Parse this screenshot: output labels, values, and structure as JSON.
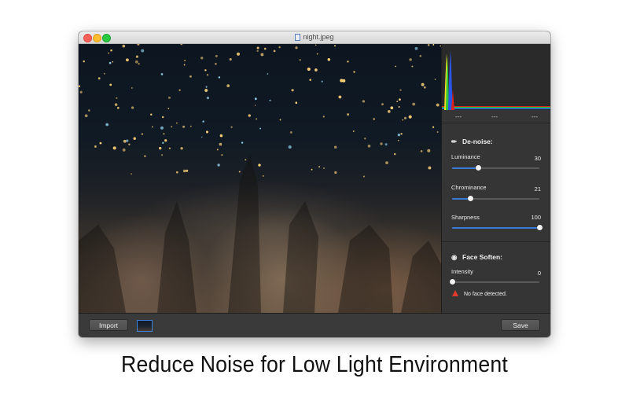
{
  "window": {
    "title": "night.jpeg",
    "title_icon": "document-icon"
  },
  "photo": {
    "description_icon": "photo-preview"
  },
  "histogram": {
    "readouts": [
      "---",
      "---",
      "---"
    ],
    "colors": {
      "red": "#e0201a",
      "green": "#2ec43c",
      "blue": "#2a55e6",
      "yellow": "#f0e020"
    }
  },
  "denoise": {
    "title": "De-noise:",
    "icon": "brush-icon",
    "sliders": [
      {
        "label": "Luminance",
        "value": "30",
        "fraction": 0.3
      },
      {
        "label": "Chrominance",
        "value": "21",
        "fraction": 0.21
      },
      {
        "label": "Sharpness",
        "value": "100",
        "fraction": 1.0
      }
    ]
  },
  "face_soften": {
    "title": "Face Soften:",
    "icon": "face-icon",
    "slider": {
      "label": "Intensity",
      "value": "0",
      "fraction": 0.0
    },
    "warning": "No face detected."
  },
  "toolbar": {
    "import_label": "Import",
    "save_label": "Save"
  },
  "caption": "Reduce Noise for Low Light Environment",
  "colors": {
    "accent": "#3a7ad9",
    "warning": "#e03a2e"
  }
}
